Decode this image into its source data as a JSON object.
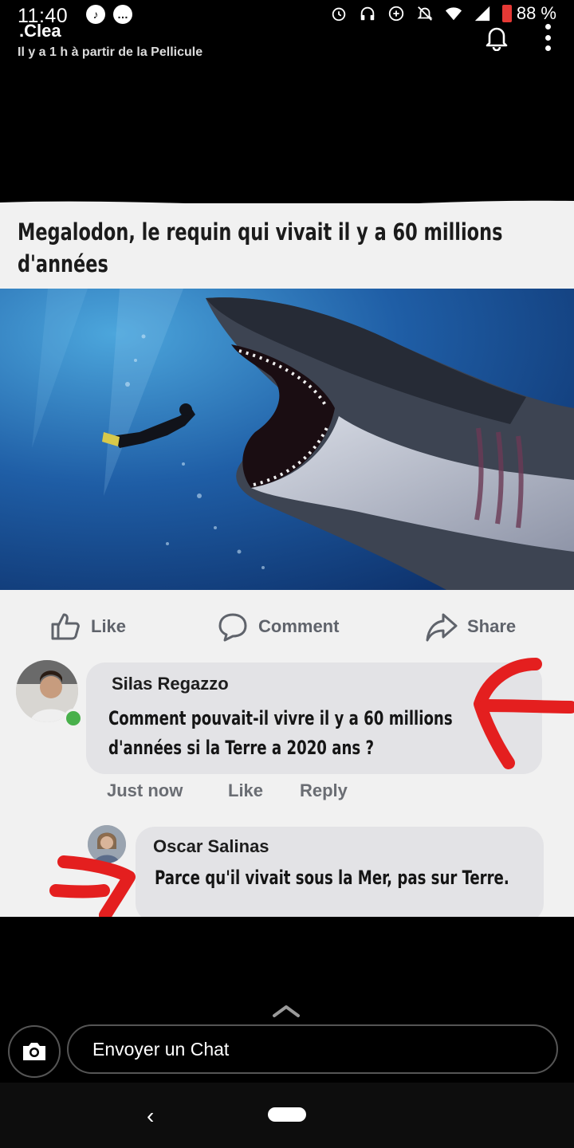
{
  "status_bar": {
    "time": "11:40",
    "battery": "88 %"
  },
  "header": {
    "sender": ".Clea",
    "subtitle": "Il y a 1 h à partir de la Pellicule"
  },
  "post": {
    "headline": "Megalodon, le requin qui vivait il y a 60 millions d'années",
    "actions": {
      "like": "Like",
      "comment": "Comment",
      "share": "Share"
    },
    "comments": [
      {
        "author": "Silas Regazzo",
        "text": "Comment pouvait-il vivre il y a 60 millions d'années si la Terre a 2020 ans ?",
        "time": "Just now",
        "like": "Like",
        "reply": "Reply"
      },
      {
        "author": "Oscar Salinas",
        "text": "Parce qu'il vivait sous la Mer, pas sur Terre."
      }
    ]
  },
  "chat_bar": {
    "placeholder": "Envoyer un Chat"
  },
  "colors": {
    "annotation_red": "#e41f1f",
    "online_green": "#48b04b",
    "facebook_gray": "#5f636b"
  }
}
